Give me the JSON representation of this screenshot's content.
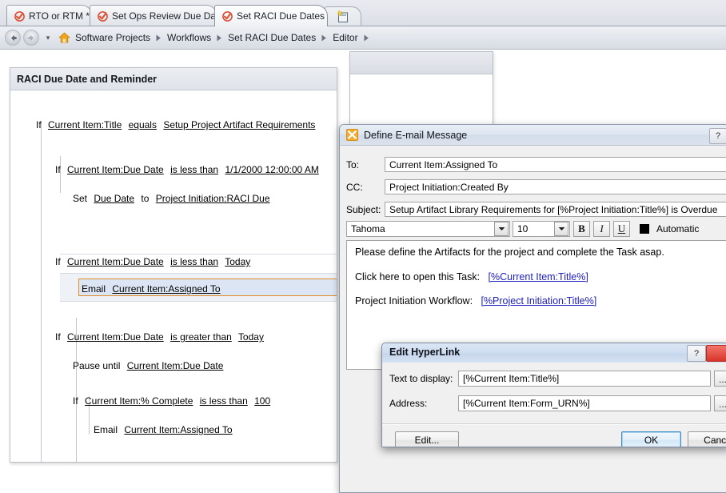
{
  "browser": {
    "tabs": [
      {
        "label": "RTO or RTM *",
        "icon": "check-circle-icon",
        "active": false
      },
      {
        "label": "Set Ops Review Due Date",
        "icon": "check-circle-icon",
        "active": false
      },
      {
        "label": "Set RACI Due Dates",
        "icon": "check-circle-icon",
        "active": true
      }
    ],
    "new_tab_icon": "new-tab-icon",
    "nav": {
      "back_icon": "back-arrow-icon",
      "forward_icon": "forward-arrow-icon",
      "history_dropdown_icon": "chevron-down-icon",
      "home_icon": "home-icon"
    },
    "breadcrumb": [
      "Software Projects",
      "Workflows",
      "Set RACI Due Dates",
      "Editor"
    ]
  },
  "workflow": {
    "title": "RACI Due Date and Reminder",
    "steps": {
      "s1": {
        "kw": "If",
        "field": "Current Item:Title",
        "op": "equals",
        "value": "Setup Project Artifact Requirements"
      },
      "s2": {
        "kw": "If",
        "field": "Current Item:Due Date",
        "op": "is less than",
        "value": "1/1/2000 12:00:00 AM"
      },
      "s3": {
        "kw": "Set",
        "field": "Due Date",
        "mid": "to",
        "value": "Project Initiation:RACI Due"
      },
      "s4": {
        "kw": "If",
        "field": "Current Item:Due Date",
        "op": "is less than",
        "value": "Today"
      },
      "s5": {
        "kw": "Email",
        "field": "Current Item:Assigned To"
      },
      "s6": {
        "kw": "If",
        "field": "Current Item:Due Date",
        "op": "is greater than",
        "value": "Today"
      },
      "s7": {
        "kw": "Pause until",
        "field": "Current Item:Due Date"
      },
      "s8": {
        "kw": "If",
        "field": "Current Item:% Complete",
        "op": "is less than",
        "value": "100"
      },
      "s9": {
        "kw": "Email",
        "field": "Current Item:Assigned To"
      }
    }
  },
  "email_dialog": {
    "title": "Define E-mail Message",
    "app_icon": "email-app-icon",
    "help_label": "?",
    "fields": {
      "to_label": "To:",
      "to_value": "Current Item:Assigned To",
      "cc_label": "CC:",
      "cc_value": "Project Initiation:Created By",
      "subject_label": "Subject:",
      "subject_value": "Setup Artifact Library Requirements for [%Project Initiation:Title%] is Overdue"
    },
    "toolbar": {
      "font_name": "Tahoma",
      "font_size": "10",
      "bold_label": "B",
      "italic_label": "I",
      "underline_label": "U",
      "color_swatch": "#000000",
      "color_label": "Automatic",
      "dropdown_icon": "chevron-down-icon"
    },
    "body": {
      "line1": "Please define the Artifacts for the project and complete the Task asap.",
      "line2_prefix": "Click here to open this Task:",
      "line2_link": "[%Current Item:Title%]",
      "line3_prefix": "Project Initiation Workflow:",
      "line3_link": "[%Project Initiation:Title%]"
    }
  },
  "hyperlink_dialog": {
    "title": "Edit HyperLink",
    "help_label": "?",
    "close_icon": "close-icon",
    "text_label": "Text to display:",
    "text_value": "[%Current Item:Title%]",
    "address_label": "Address:",
    "address_value": "[%Current Item:Form_URN%]",
    "browse_label": "...",
    "edit_button": "Edit...",
    "ok_button": "OK",
    "cancel_button": "Cance"
  }
}
